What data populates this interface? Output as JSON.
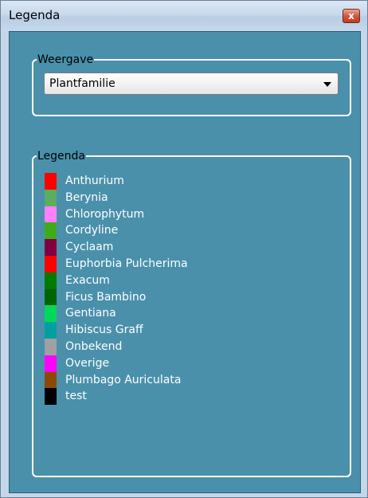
{
  "window": {
    "title": "Legenda",
    "close_label": "x"
  },
  "weergave": {
    "label": "Weergave",
    "selected": "Plantfamilie"
  },
  "legenda": {
    "label": "Legenda",
    "items": [
      {
        "label": "Anthurium",
        "color": "#ff0000"
      },
      {
        "label": "Berynia",
        "color": "#5aae5e"
      },
      {
        "label": "Chlorophytum",
        "color": "#ff80ff"
      },
      {
        "label": "Cordyline",
        "color": "#3faa1a"
      },
      {
        "label": "Cyclaam",
        "color": "#800040"
      },
      {
        "label": "Euphorbia Pulcherima",
        "color": "#ff0000"
      },
      {
        "label": "Exacum",
        "color": "#007a00"
      },
      {
        "label": "Ficus Bambino",
        "color": "#006400"
      },
      {
        "label": "Gentiana",
        "color": "#00d85a"
      },
      {
        "label": "Hibiscus Graff",
        "color": "#00a0a0"
      },
      {
        "label": "Onbekend",
        "color": "#a0a0a0"
      },
      {
        "label": "Overige",
        "color": "#ff00ff"
      },
      {
        "label": "Plumbago Auriculata",
        "color": "#8b4a00"
      },
      {
        "label": "test",
        "color": "#000000"
      }
    ]
  }
}
